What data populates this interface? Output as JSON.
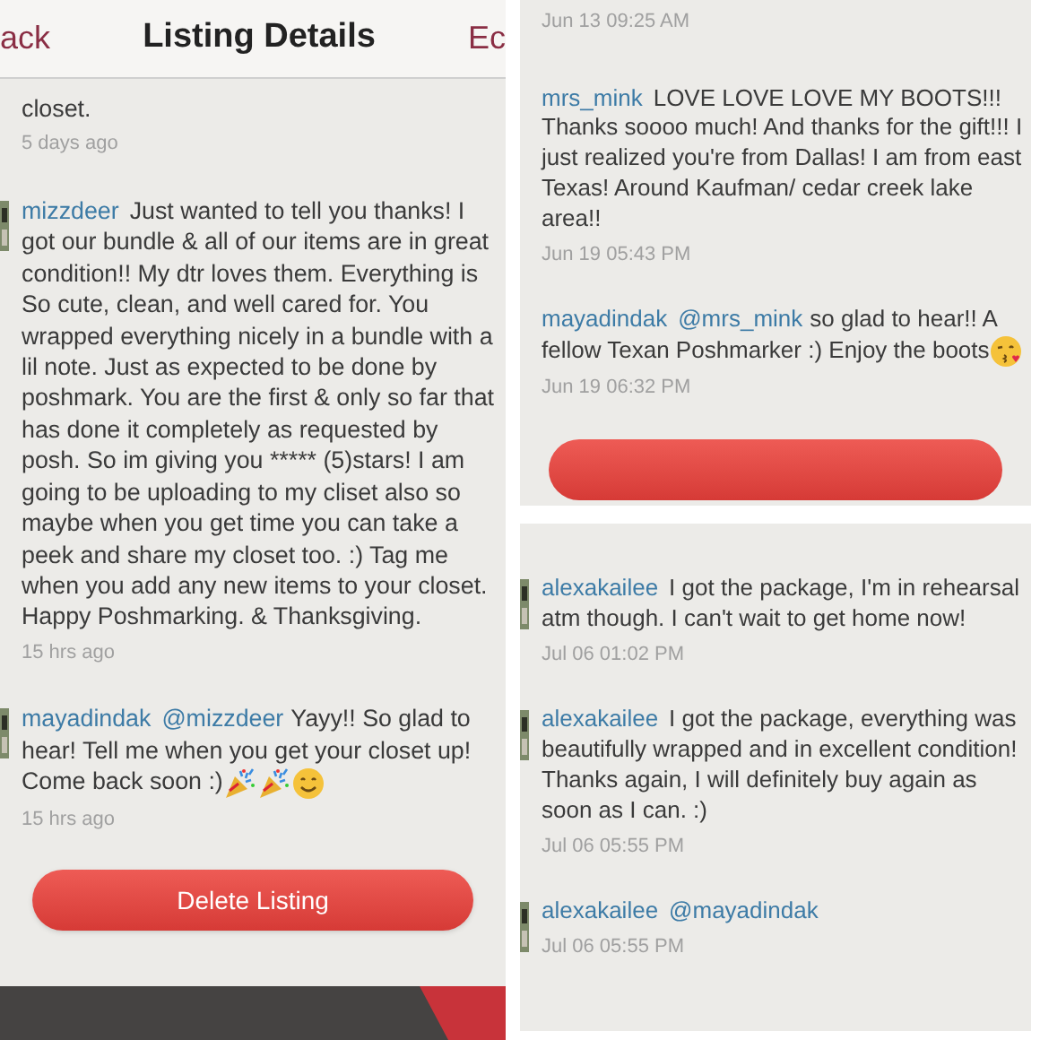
{
  "left_panel": {
    "header": {
      "back": "ack",
      "title": "Listing Details",
      "edit": "Ec"
    },
    "comments": [
      {
        "avatar": false,
        "text": "closet.",
        "time": "5 days ago"
      },
      {
        "avatar": true,
        "user": "mizzdeer",
        "text": "Just wanted to tell you thanks! I got our bundle & all of our items are in great condition!! My dtr loves them. Everything is So cute, clean, and well cared for. You wrapped everything nicely in a bundle with a lil note. Just as expected to be done by poshmark. You are the first & only so far that has done it completely as requested by posh. So im giving you ***** (5)stars! I am going to be uploading to my cliset also so maybe when you get time you can take a peek and share my closet too. :) Tag me when you add any new items to your closet. Happy Poshmarking. & Thanksgiving.",
        "time": "15 hrs ago"
      },
      {
        "avatar": true,
        "user": "mayadindak",
        "mention": "@mizzdeer",
        "text": "Yayy!! So glad to hear! Tell me when you get your closet up! Come back soon :)",
        "emoji": [
          {
            "kind": "party"
          },
          {
            "kind": "party"
          },
          {
            "kind": "smile"
          }
        ],
        "time": "15 hrs ago"
      }
    ],
    "button": "Delete Listing"
  },
  "right_top_panel": {
    "comments": [
      {
        "avatar": false,
        "time": "Jun 13 09:25 AM"
      },
      {
        "avatar": false,
        "user": "mrs_mink",
        "text": "LOVE LOVE LOVE MY BOOTS!!! Thanks soooo much! And thanks for the gift!!! I just realized you're from Dallas! I am from east Texas! Around Kaufman/ cedar creek lake area!!",
        "time": "Jun 19 05:43 PM"
      },
      {
        "avatar": false,
        "user": "mayadindak",
        "mention": "@mrs_mink",
        "text": "so glad to hear!! A fellow Texan Poshmarker :)  Enjoy the boots",
        "emoji": [
          {
            "kind": "kiss"
          }
        ],
        "time": "Jun 19 06:32 PM"
      }
    ]
  },
  "right_bottom_panel": {
    "comments": [
      {
        "avatar": true,
        "user": "alexakailee",
        "text": "I got the package, I'm in rehearsal atm though. I can't wait to get home now!",
        "time": "Jul 06 01:02 PM"
      },
      {
        "avatar": true,
        "user": "alexakailee",
        "text": "I got the package, everything was beautifully wrapped and in excellent condition! Thanks again, I will definitely buy again as soon as I can. :)",
        "time": "Jul 06 05:55 PM"
      },
      {
        "avatar": true,
        "user": "alexakailee",
        "mention": "@mayadindak",
        "time": "Jul 06 05:55 PM"
      }
    ]
  }
}
